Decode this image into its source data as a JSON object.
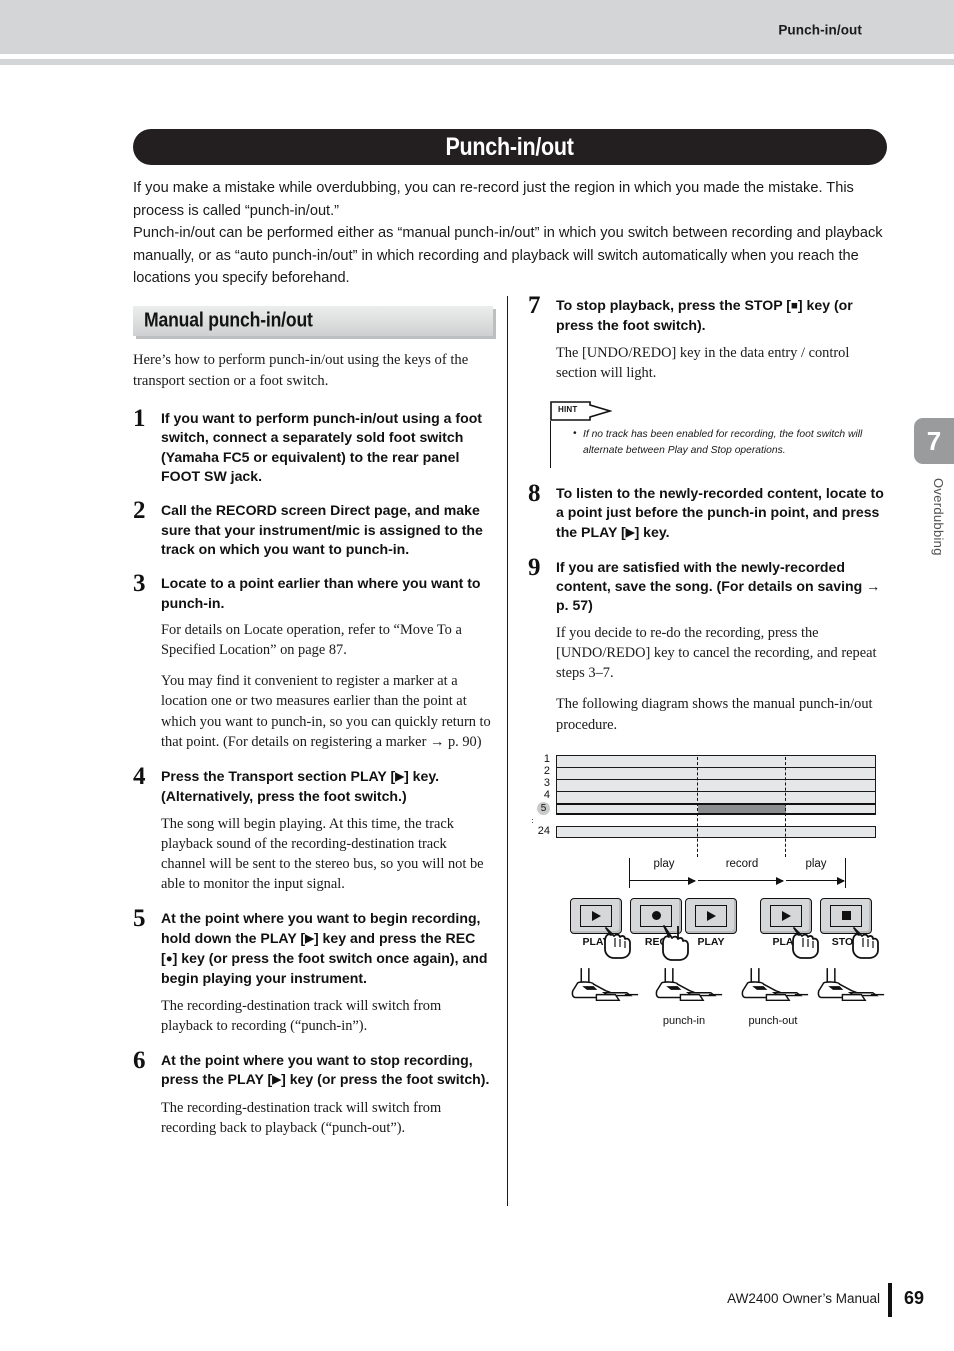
{
  "header": {
    "running_head": "Punch-in/out"
  },
  "title": "Punch-in/out",
  "intro": "If you make a mistake while overdubbing, you can re-record just the region in which you made the mistake. This process is called “punch-in/out.” Punch-in/out can be performed either as “manual punch-in/out” in which you switch between recording and playback manually, or as “auto punch-in/out” in which recording and playback will switch automatically when you reach the locations you specify beforehand.",
  "intro_line1": "If you make a mistake while overdubbing, you can re-record just the region in which you made the mistake. This process is called “punch-in/out.”",
  "intro_line2": "Punch-in/out can be performed either as “manual punch-in/out” in which you switch between recording and playback manually, or as “auto punch-in/out” in which recording and playback will switch automatically when you reach the locations you specify beforehand.",
  "section": {
    "heading": "Manual punch-in/out",
    "lead": "Here’s how to perform punch-in/out using the keys of the transport section or a foot switch."
  },
  "steps": [
    {
      "num": "1",
      "title": "If you want to perform punch-in/out using a foot switch, connect a separately sold foot switch (Yamaha FC5 or equivalent) to the rear panel FOOT SW jack.",
      "body": []
    },
    {
      "num": "2",
      "title": "Call the RECORD screen Direct page, and make sure that your instrument/mic is assigned to the track on which you want to punch-in.",
      "body": []
    },
    {
      "num": "3",
      "title": "Locate to a point earlier than where you want to punch-in.",
      "body": [
        "For details on Locate operation, refer to “Move To a Specified Location” on page 87.",
        "You may find it convenient to register a marker at a location one or two measures earlier than the point at which you want to punch-in, so you can quickly return to that point. (For details on registering a marker → p. 90)"
      ]
    },
    {
      "num": "4",
      "title_pre": "Press the Transport section PLAY [",
      "title_glyph": "▶",
      "title_post": "] key. (Alternatively, press the foot switch.)",
      "body": [
        "The song will begin playing. At this time, the track playback sound of the recording-destination track channel will be sent to the stereo bus, so you will not be able to monitor the input signal."
      ]
    },
    {
      "num": "5",
      "title_pre": "At the point where you want to begin recording, hold down the PLAY [",
      "title_glyph": "▶",
      "title_mid": "] key and press the REC [",
      "title_glyph2": "●",
      "title_post": "] key (or press the foot switch once again), and begin playing your instrument.",
      "body": [
        "The recording-destination track will switch from playback to recording (“punch-in”)."
      ]
    },
    {
      "num": "6",
      "title_pre": "At the point where you want to stop recording, press the PLAY [",
      "title_glyph": "▶",
      "title_post": "] key (or press the foot switch).",
      "body": [
        "The recording-destination track will switch from recording back to playback (“punch-out”)."
      ]
    },
    {
      "num": "7",
      "title_pre": "To stop playback, press the STOP [",
      "title_glyph": "■",
      "title_post": "] key (or press the foot switch).",
      "body": [
        "The [UNDO/REDO] key in the data entry / control section will light."
      ]
    },
    {
      "num": "8",
      "title_pre": "To listen to the newly-recorded content, locate to a point just before the punch-in point, and press the PLAY [",
      "title_glyph": "▶",
      "title_post": "] key.",
      "body": []
    },
    {
      "num": "9",
      "title": "If you are satisfied with the newly-recorded content, save the song. (For details on saving → p. 57)",
      "body": [
        "If you decide to re-do the recording, press the [UNDO/REDO] key to cancel the recording, and repeat steps 3–7.",
        "The following diagram shows the manual punch-in/out procedure."
      ]
    }
  ],
  "hint": {
    "tag": "HINT",
    "items": [
      "If no track has been enabled for recording, the foot switch will alternate between Play and Stop operations."
    ]
  },
  "diagram": {
    "track_labels": [
      "1",
      "2",
      "3",
      "4",
      "5",
      "··",
      "24"
    ],
    "highlighted_track": "5",
    "timeline_labels": [
      "play",
      "record",
      "play"
    ],
    "buttons": [
      {
        "label": "PLAY",
        "glyph": "triangle"
      },
      {
        "label": "REC",
        "glyph": "circle"
      },
      {
        "label": "PLAY",
        "glyph": "triangle"
      },
      {
        "label": "PLAY",
        "glyph": "triangle"
      },
      {
        "label": "STOP",
        "glyph": "square"
      }
    ],
    "pedal_labels": [
      "punch-in",
      "punch-out"
    ]
  },
  "side_tab": {
    "number": "7",
    "chapter": "Overdubbing"
  },
  "footer": {
    "manual": "AW2400  Owner’s Manual",
    "page": "69"
  },
  "colors": {
    "header_gray": "#d4d5d7",
    "banner_black": "#231f20",
    "track_fill": "#e6e7e8",
    "record_fill": "#8c8d8f",
    "tab_gray": "#9a9b9d"
  }
}
